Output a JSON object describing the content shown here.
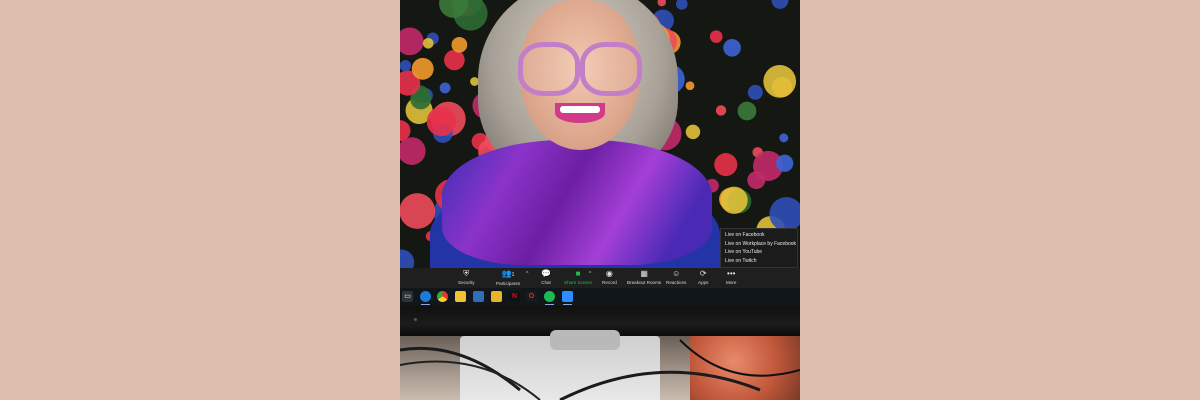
{
  "live_menu": {
    "items": [
      "Live on Facebook",
      "Live on Workplace by Facebook",
      "Live on YouTube",
      "Live on Twitch"
    ]
  },
  "toolbar": {
    "security": "Security",
    "participants": "Participants",
    "participants_count": "1",
    "chat": "Chat",
    "share_screen": "Share Screen",
    "record": "Record",
    "breakout_rooms": "Breakout Rooms",
    "reactions": "Reactions",
    "apps": "Apps",
    "more": "More"
  },
  "taskbar": {
    "apps": [
      "edge-icon",
      "chrome-icon",
      "notes-icon",
      "photos-icon",
      "explorer-icon",
      "netflix-icon",
      "opera-icon",
      "spotify-icon",
      "zoom-icon"
    ]
  },
  "colors": {
    "share_green": "#19c24a",
    "toolbar_bg": "#1f1f1f",
    "taskbar_bg": "#11161a",
    "side_bg": "#dcbfae"
  }
}
